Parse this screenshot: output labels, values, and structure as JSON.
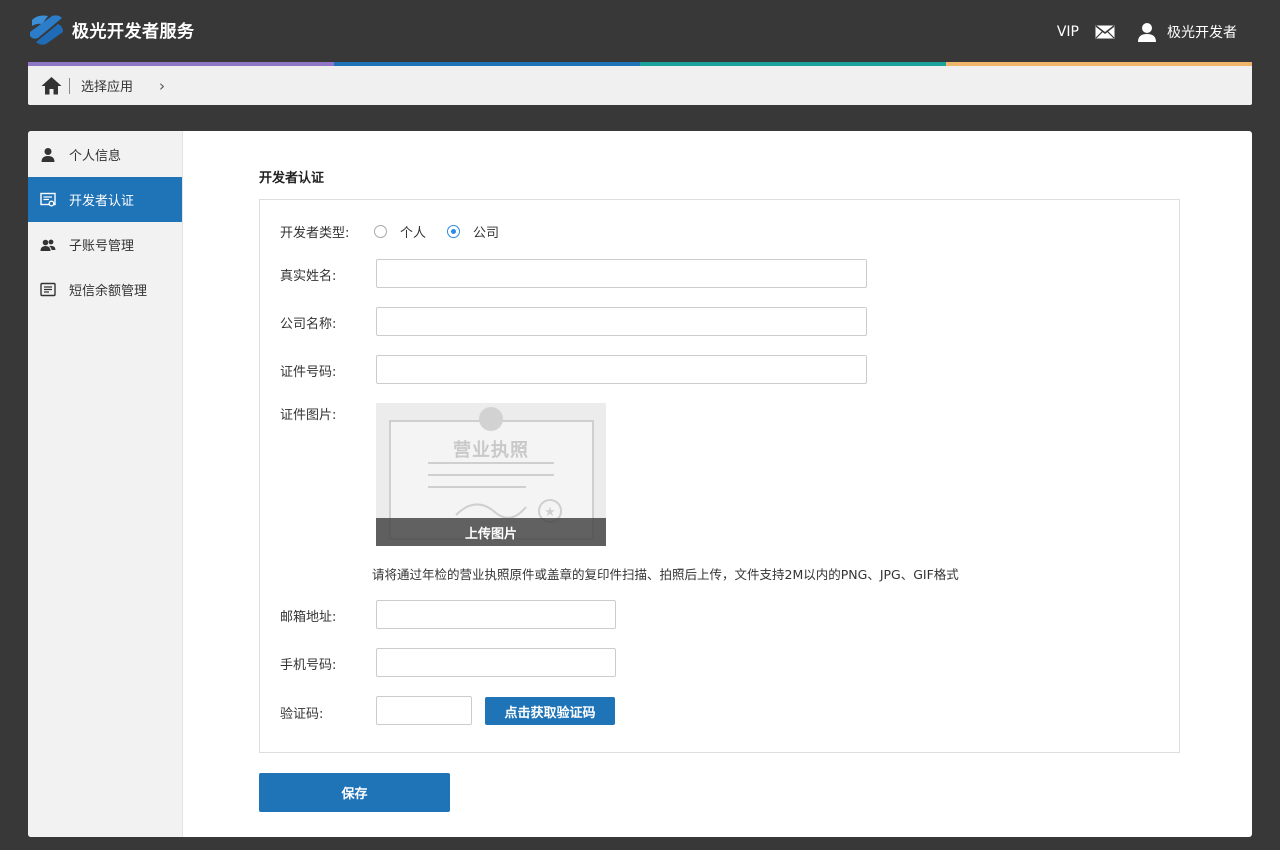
{
  "header": {
    "brand": "极光开发者服务",
    "vip_label": "VIP",
    "user_name": "极光开发者"
  },
  "breadcrumb": {
    "select_app": "选择应用"
  },
  "colors": {
    "accent_stripes": [
      "#8f76c6",
      "#1f73b7",
      "#1aa39a",
      "#f0b46a"
    ],
    "primary": "#1f73b7"
  },
  "sidebar": {
    "items": [
      {
        "label": "个人信息",
        "icon": "user-icon",
        "active": false
      },
      {
        "label": "开发者认证",
        "icon": "certificate-icon",
        "active": true
      },
      {
        "label": "子账号管理",
        "icon": "users-icon",
        "active": false
      },
      {
        "label": "短信余额管理",
        "icon": "message-list-icon",
        "active": false
      }
    ]
  },
  "form": {
    "section_title": "开发者认证",
    "type_label": "开发者类型:",
    "type_options": [
      {
        "label": "个人",
        "selected": false
      },
      {
        "label": "公司",
        "selected": true
      }
    ],
    "real_name_label": "真实姓名:",
    "real_name_value": "",
    "company_label": "公司名称:",
    "company_value": "",
    "id_label": "证件号码:",
    "id_value": "",
    "image_label": "证件图片:",
    "license_watermark": "营业执照",
    "upload_label": "上传图片",
    "upload_hint": "请将通过年检的营业执照原件或盖章的复印件扫描、拍照后上传，文件支持2M以内的PNG、JPG、GIF格式",
    "email_label": "邮箱地址:",
    "email_value": "",
    "phone_label": "手机号码:",
    "phone_value": "",
    "code_label": "验证码:",
    "code_value": "",
    "get_code_label": "点击获取验证码",
    "save_label": "保存"
  }
}
